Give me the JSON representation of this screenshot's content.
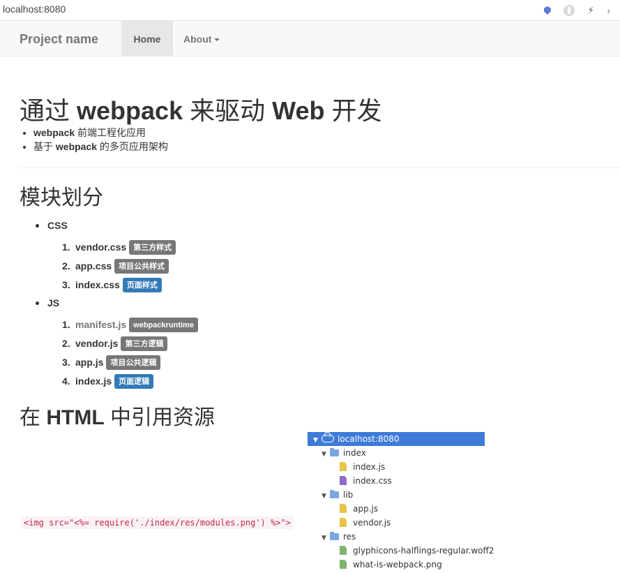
{
  "browser": {
    "url": "localhost:8080"
  },
  "navbar": {
    "brand": "Project name",
    "home": "Home",
    "about": "About"
  },
  "hero": {
    "title_parts": [
      "通过 ",
      "webpack",
      " 来驱动 ",
      "Web",
      " 开发"
    ],
    "bullets": [
      {
        "strong": "webpack",
        "text": " 前端工程化应用",
        "prefix": ""
      },
      {
        "prefix": "基于 ",
        "strong": "webpack",
        "text": " 的多页应用架构"
      }
    ]
  },
  "modules": {
    "title": "模块划分",
    "css": {
      "label": "CSS",
      "items": [
        {
          "num": "1.",
          "name": "vendor.css",
          "badge": "第三方样式",
          "badge_color": "#777777"
        },
        {
          "num": "2.",
          "name": "app.css",
          "badge": "项目公共样式",
          "badge_color": "#777777"
        },
        {
          "num": "3.",
          "name": "index.css",
          "badge": "页面样式",
          "badge_color": "#337ab7"
        }
      ]
    },
    "js": {
      "label": "JS",
      "items": [
        {
          "num": "1.",
          "name": "manifest.js",
          "badge": "webpackruntime",
          "badge_color": "#777777"
        },
        {
          "num": "2.",
          "name": "vendor.js",
          "badge": "第三方逻辑",
          "badge_color": "#777777"
        },
        {
          "num": "3.",
          "name": "app.js",
          "badge": "项目公共逻辑",
          "badge_color": "#777777"
        },
        {
          "num": "4.",
          "name": "index.js",
          "badge": "页面逻辑",
          "badge_color": "#337ab7"
        }
      ]
    }
  },
  "html_section": {
    "title_parts": [
      "在 ",
      "HTML",
      " 中引用资源"
    ],
    "code": "<img src=\"<%= require('./index/res/modules.png') %>\">"
  },
  "tree": {
    "root": "localhost:8080",
    "folders": {
      "index": "index",
      "lib": "lib",
      "res": "res"
    },
    "files": {
      "index_js": "index.js",
      "index_css": "index.css",
      "app_js": "app.js",
      "vendor_js": "vendor.js",
      "woff": "glyphicons-halflings-regular.woff2",
      "png": "what-is-webpack.png"
    },
    "colors": {
      "selected": "#3d7bd9",
      "folder": "#7aa7e0",
      "js": "#e8c547",
      "css": "#8e6cc9",
      "asset": "#7db56e"
    }
  }
}
